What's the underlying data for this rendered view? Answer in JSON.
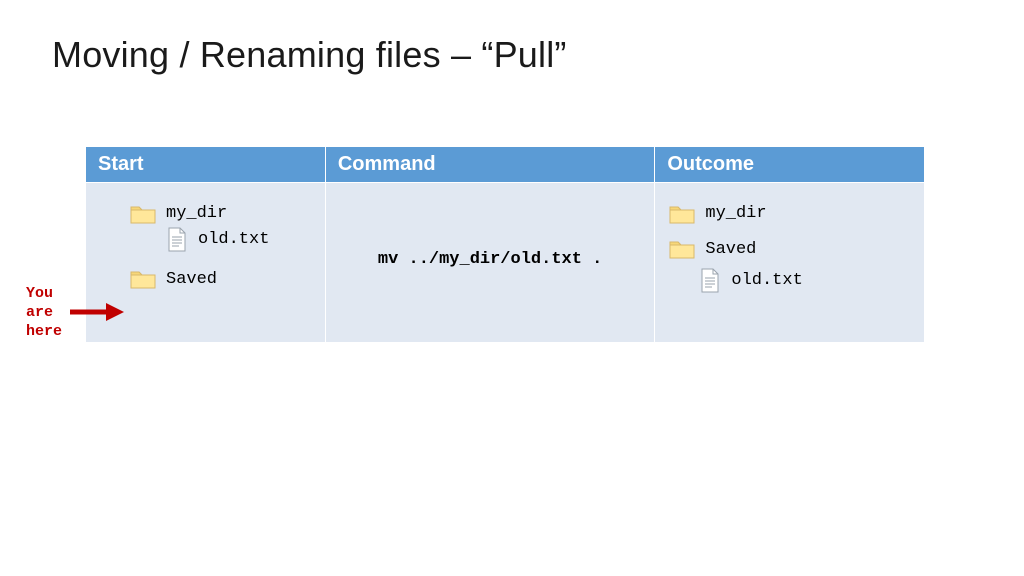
{
  "title": "Moving / Renaming files – “Pull”",
  "headers": {
    "c1": "Start",
    "c2": "Command",
    "c3": "Outcome"
  },
  "start": {
    "dir1": "my_dir",
    "file1": "old.txt",
    "dir2": "Saved"
  },
  "command": "mv ../my_dir/old.txt .",
  "outcome": {
    "dir1": "my_dir",
    "dir2": "Saved",
    "file1": "old.txt"
  },
  "callout": {
    "l1": "You",
    "l2": "are",
    "l3": "here"
  }
}
